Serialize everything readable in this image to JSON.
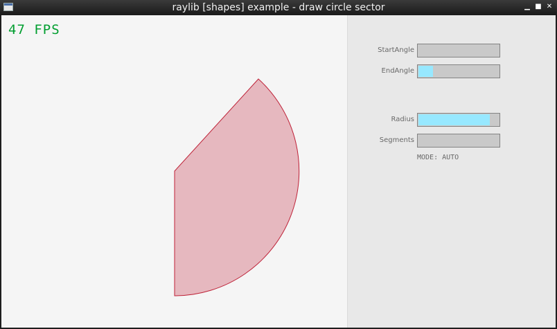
{
  "window": {
    "title": "raylib [shapes] example - draw circle sector",
    "controls": {
      "minimize": "▁",
      "maximize": "■",
      "close": "✕"
    }
  },
  "hud": {
    "fps_text": "47 FPS"
  },
  "sector": {
    "fill_color": "#e6b8bf",
    "outline_color": "#be2137"
  },
  "controls": {
    "start_angle": {
      "label": "StartAngle",
      "fraction": 0.0
    },
    "end_angle": {
      "label": "EndAngle",
      "fraction": 0.18
    },
    "radius": {
      "label": "Radius",
      "fraction": 0.89
    },
    "segments": {
      "label": "Segments",
      "fraction": 0.0
    },
    "mode_text": "MODE: AUTO"
  },
  "colors": {
    "fps": "#009e2f",
    "slider_fill": "#97e8ff",
    "panel_bg": "#e8e8e8",
    "canvas_bg": "#f5f5f5"
  }
}
